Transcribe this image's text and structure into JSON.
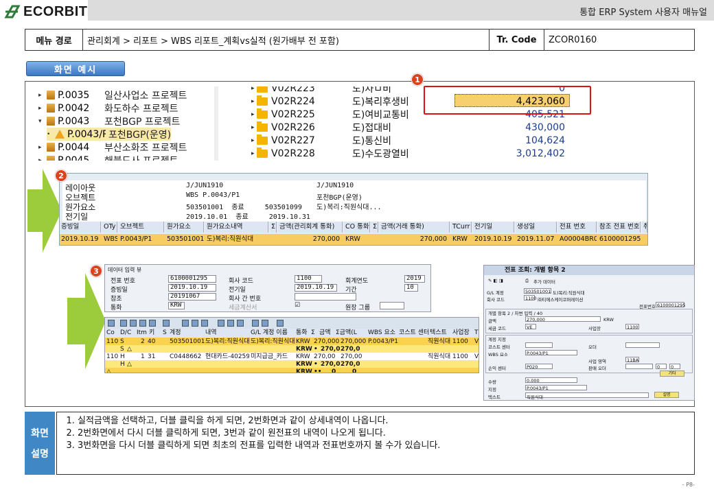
{
  "header": {
    "logo_text": "ECORBIT",
    "doc_title": "통합 ERP System 사용자 매뉴얼"
  },
  "menu": {
    "path_label": "메뉴 경로",
    "path_value": "관리회계 > 리포트 > WBS 리포트_계획vs실적 (원가배부 전 포함)",
    "code_label": "Tr. Code",
    "code_value": "ZCOR0160"
  },
  "section_title": "화면 예시",
  "badges": [
    "1",
    "2",
    "3"
  ],
  "tree": [
    {
      "code": "P.0035",
      "desc": "일산사업소 프로젝트"
    },
    {
      "code": "P.0042",
      "desc": "화도하수 프로젝트"
    },
    {
      "code": "P.0043",
      "desc": "포천BGP 프로젝트"
    },
    {
      "code": "P.0043/P",
      "desc": "포천BGP(운영)"
    },
    {
      "code": "P.0044",
      "desc": "부산소화조 프로젝트"
    },
    {
      "code": "P.0045",
      "desc": "해블드사 프로젝트"
    }
  ],
  "folders": [
    {
      "code": "V02R223",
      "desc": "도)차ㅁ비",
      "amount": "0"
    },
    {
      "code": "V02R224",
      "desc": "도)복리후생비",
      "amount": "4,423,060"
    },
    {
      "code": "V02R225",
      "desc": "도)여비교통비",
      "amount": "405,521"
    },
    {
      "code": "V02R226",
      "desc": "도)접대비",
      "amount": "430,000"
    },
    {
      "code": "V02R227",
      "desc": "도)통신비",
      "amount": "104,624"
    },
    {
      "code": "V02R228",
      "desc": "도)수도광열비",
      "amount": "3,012,402"
    }
  ],
  "step2": {
    "header_rows": [
      {
        "label": "레이아웃",
        "v1": "J/JUN1910",
        "v2": "J/JUN1910"
      },
      {
        "label": "오브젝트",
        "v1": "WBS P.0043/P1",
        "v2": "포천BGP(운영)"
      },
      {
        "label": "원가요소",
        "v1": "503501001  종료     503501099",
        "v2": "도)복리:직원식대..."
      },
      {
        "label": "전기일",
        "v1": "2019.10.01  종료     2019.10.31",
        "v2": ""
      }
    ],
    "columns": [
      "증빙일",
      "OTy",
      "오브젝트",
      "원가요소",
      "원가요소내역",
      "Σ",
      "금액(관리회계 통화)",
      "CO 통화",
      "Σ",
      "금액(거래 통화)",
      "TCurr",
      "전기일",
      "생성일",
      "전표 번호",
      "참조 전표 번호",
      "취"
    ],
    "row": [
      "2019.10.19",
      "WBS",
      "P.0043/P1",
      "503501001",
      "도)복리:직원식대",
      "",
      "270,000",
      "KRW",
      "",
      "270,000",
      "KRW",
      "2019.10.19",
      "2019.11.07",
      "A00004BR00",
      "6100001295",
      ""
    ]
  },
  "step3": {
    "panel_title": "데이터 입력 뷰",
    "fields": [
      {
        "label": "전표 번호",
        "value": "6100001295",
        "label2": "회사 코드",
        "value2": "1100",
        "label3": "회계연도",
        "value3": "2019"
      },
      {
        "label": "증빙일",
        "value": "2019.10.19",
        "label2": "전기일",
        "value2": "2019.10.19",
        "label3": "기간",
        "value3": "10"
      },
      {
        "label": "참조",
        "value": "20191067",
        "label2": "회사 간 번호",
        "value2": "",
        "label3": "",
        "value3": ""
      },
      {
        "label": "통화",
        "value": "KRW",
        "label2": "세금계산서",
        "value2": "",
        "label3": "원장 그룹",
        "value3": ""
      }
    ],
    "grid_headers": [
      "Co",
      "D/C",
      "Itm",
      "키",
      "S",
      "계정",
      "내역",
      "G/L 계정 이름",
      "통화",
      "Σ",
      "금액",
      "Σ금액(L",
      "WBS 요소",
      "코스트 센터",
      "텍스트",
      "사업장",
      "Tx"
    ],
    "rows": [
      [
        "110",
        "S",
        "2",
        "40",
        "",
        "503501001",
        "도)복리:직원식대",
        "도)복리:직원식대",
        "KRW",
        "",
        "270,000",
        "270,000",
        "P.0043/P1",
        "",
        "직원식대",
        "1100",
        "VE"
      ],
      [
        "",
        "S",
        "",
        "",
        "",
        "",
        "",
        "",
        "KRW",
        "•",
        "270,0",
        "270,0",
        "",
        "",
        "",
        "",
        ""
      ],
      [
        "110",
        "H",
        "1",
        "31",
        "",
        "C0448662",
        "현대카드-40259",
        "미지급금_카드",
        "KRW",
        "",
        "270,00",
        "270,00",
        "",
        "",
        "직원식대",
        "1100",
        "VE"
      ],
      [
        "",
        "H",
        "",
        "",
        "",
        "",
        "",
        "",
        "KRW",
        "•",
        "270,0",
        "270,0",
        "",
        "",
        "",
        "",
        ""
      ],
      [
        "",
        "",
        "",
        "",
        "",
        "",
        "",
        "",
        "KRW",
        "••",
        "0",
        "0",
        "",
        "",
        "",
        "",
        ""
      ]
    ]
  },
  "dialog": {
    "title": "전표 조회: 개별 항목 2",
    "toolbar_text": "추가 데이터",
    "gl_label": "G/L 계정",
    "gl_value": "503501001",
    "gl_desc": "도)복리:직원식대",
    "co_label": "회사 코드",
    "co_value": "1100",
    "co_desc": "㈜티에스케이코퍼레이션",
    "doc_no_label": "전표번호",
    "doc_no_value": "6100001295",
    "sec1": "개별 항목 2 / 차변 입력 / 40",
    "amt_label": "금액",
    "amt_value": "270,000",
    "amt_cur": "KRW",
    "tax_label": "세금 코드",
    "tax_value": "VE",
    "biz_label": "사업장",
    "biz_value": "1100",
    "sec2": "계정 지정",
    "cc_label": "코스트 센터",
    "order_label": "오더",
    "wbs_label": "WBS 요소",
    "wbs_value": "P.0043/P1",
    "bizarea_label": "사업 영역",
    "bizarea_value": "11BA",
    "profit_label": "손익 센터",
    "profit_value": "P020",
    "partner_label": "판매 오더",
    "partner_v1": "0",
    "partner_v2": "0",
    "more_btn": "기타",
    "qty_label": "수량",
    "qty_value": "0.000",
    "assign_label": "지정",
    "assign_value": "P.0043/P1",
    "text_label": "텍스트",
    "text_value": "직원식대",
    "long_btn": "설명"
  },
  "explanation": {
    "label_line1": "화면",
    "label_line2": "설명",
    "items": [
      "실적금액을 선택하고, 더블 클릭을 하게 되면, 2번화면과 같이 상세내역이 나옵니다.",
      "2번화면에서 다시 더블 클릭하게 되면, 3번과 같이 원전표의 내역이 나오게 됩니다.",
      "3번화면을 다시 더블 클릭하게 되면 최초의 전표를 입력한 내역과 전표번호까지 볼 수가 있습니다."
    ]
  },
  "page_number": "- P8-"
}
